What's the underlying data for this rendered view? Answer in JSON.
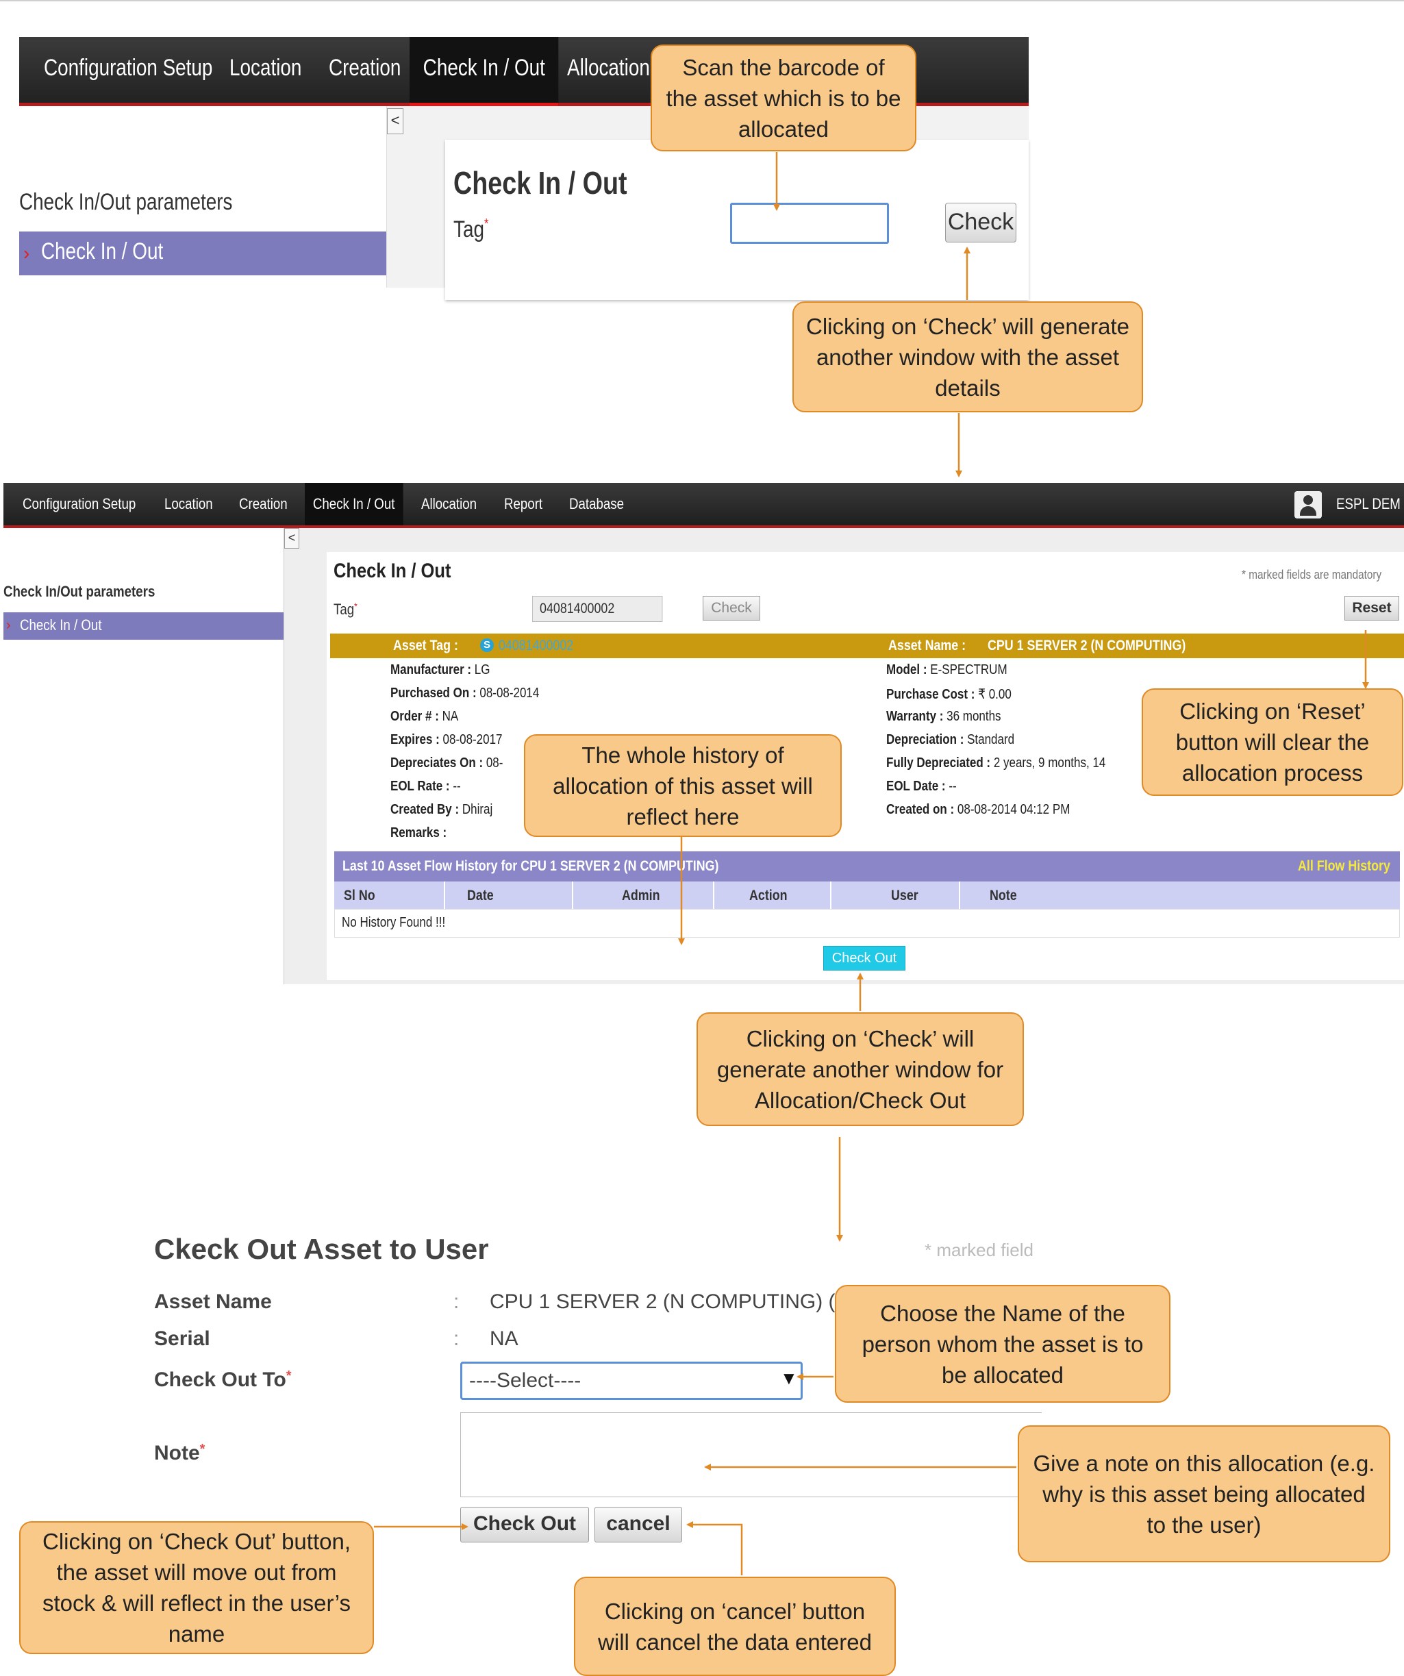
{
  "shot1": {
    "nav": [
      "Configuration Setup",
      "Location",
      "Creation",
      "Check In / Out",
      "Allocation"
    ],
    "collapse_glyph": "<",
    "sidebar_heading": "Check In/Out parameters",
    "sidebar_item": "Check In / Out",
    "page_title": "Check In / Out",
    "tag_label": "Tag",
    "required_mark": "*",
    "tag_value": "",
    "check_label": "Check"
  },
  "shot2": {
    "nav": [
      "Configuration Setup",
      "Location",
      "Creation",
      "Check In / Out",
      "Allocation",
      "Report",
      "Database"
    ],
    "user_name": "ESPL DEM",
    "collapse_glyph": "<",
    "sidebar_heading": "Check In/Out parameters",
    "sidebar_item": "Check In / Out",
    "page_title": "Check In / Out",
    "mandatory_note": "* marked fields are mandatory",
    "tag_label": "Tag",
    "required_mark": "*",
    "tag_value": "04081400002",
    "check_label": "Check",
    "reset_label": "Reset",
    "asset_tag_label": "Asset Tag :",
    "asset_tag_badge": "S",
    "asset_tag_value": "04081400002",
    "asset_name_label": "Asset Name :",
    "asset_name_value": "CPU 1 SERVER 2 (N COMPUTING)",
    "left_fields": [
      {
        "label": "Manufacturer :",
        "value": "LG"
      },
      {
        "label": "Purchased On :",
        "value": "08-08-2014"
      },
      {
        "label": "Order # :",
        "value": "NA"
      },
      {
        "label": "Expires :",
        "value": "08-08-2017"
      },
      {
        "label": "Depreciates On :",
        "value": "08-"
      },
      {
        "label": "EOL Rate :",
        "value": "--"
      },
      {
        "label": "Created By :",
        "value": "Dhiraj"
      },
      {
        "label": "Remarks :",
        "value": ""
      }
    ],
    "right_fields": [
      {
        "label": "Model :",
        "value": "E-SPECTRUM"
      },
      {
        "label": "Purchase Cost :",
        "value": "₹ 0.00"
      },
      {
        "label": "Warranty :",
        "value": "36 months"
      },
      {
        "label": "Depreciation :",
        "value": "Standard"
      },
      {
        "label": "Fully Depreciated :",
        "value": "2 years, 9 months, 14"
      },
      {
        "label": "EOL Date :",
        "value": "--"
      },
      {
        "label": "Created on :",
        "value": "08-08-2014 04:12 PM"
      }
    ],
    "history_title": "Last 10 Asset Flow History for CPU 1 SERVER 2 (N COMPUTING)",
    "all_history_link": "All Flow History",
    "columns": [
      "Sl No",
      "Date",
      "Admin",
      "Action",
      "User",
      "Note"
    ],
    "empty_message": "No History Found !!!",
    "checkout_label": "Check Out"
  },
  "dialog": {
    "title": "Ckeck Out Asset to User",
    "mandatory_note": "* marked field",
    "asset_name_label": "Asset Name",
    "asset_name_value": "CPU 1 SERVER 2 (N COMPUTING) (T",
    "serial_label": "Serial",
    "serial_value": "NA",
    "checkout_to_label": "Check Out To",
    "required_mark": "*",
    "colon": ":",
    "select_value": "----Select----",
    "note_label": "Note",
    "note_value": "",
    "checkout_label": "Check Out",
    "cancel_label": "cancel"
  },
  "callouts": {
    "scan": "Scan the barcode of the asset which is to be allocated",
    "check1": "Clicking on ‘Check’ will generate another window with the asset details",
    "reset": "Clicking on ‘Reset’ button will clear the allocation process",
    "history": "The whole history of allocation of this asset will reflect here",
    "check2": "Clicking on ‘Check’ will generate another window for Allocation/Check Out",
    "choose": "Choose the Name of the person whom the asset is to be allocated",
    "note": "Give a note on this allocation (e.g. why is this asset being allocated to the user)",
    "checkout": "Clicking on ‘Check Out’ button, the asset will move out from stock & will reflect in the user’s name",
    "cancel": "Clicking on ‘cancel’ button will cancel the data entered"
  },
  "colors": {
    "callout_fill": "#f9c98a",
    "callout_border": "#e08a26",
    "nav_accent": "#b41d1d",
    "gold_bar": "#c99a10",
    "purple_bar": "#8a86c7",
    "check_out_button": "#20c9e6"
  }
}
